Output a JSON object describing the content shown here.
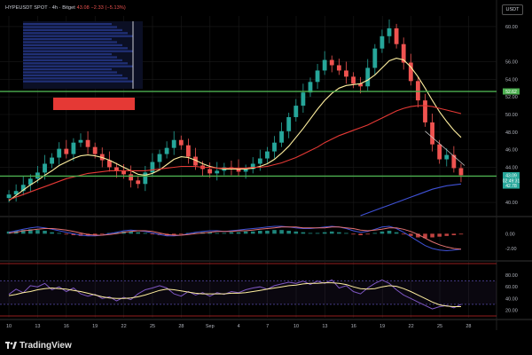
{
  "header": {
    "symbol": "HYPEUSDT SPOT · 4h · Bitget",
    "last": "43.08",
    "change": "−2.33 (−5.13%)"
  },
  "currency_label": "USDT",
  "branding": "TradingView",
  "colors": {
    "background": "#000000",
    "grid": "#1a1a1a",
    "up": "#26a69a",
    "down": "#ef5350",
    "ma_fast": "#ffef9f",
    "ma_mid": "#e53935",
    "ma_slow": "#3f51d6",
    "level": "#4caf50",
    "macd": "#3f51d6",
    "signal": "#e57373",
    "rsi": "#7e57c2",
    "rsi_ma": "#ffef9f"
  },
  "chart_data": [
    {
      "type": "line",
      "title": "",
      "ylabel": "",
      "xlabel": "",
      "x_tick_labels": [
        "10",
        "13",
        "16",
        "19",
        "22",
        "25",
        "28",
        "Sep",
        "4",
        "7",
        "10",
        "13",
        "16",
        "19",
        "22",
        "25",
        "28"
      ],
      "y_ticks": [
        "60.00",
        "56.00",
        "54.00",
        "52.00",
        "50.00",
        "48.00",
        "46.00",
        "44.00",
        "40.00"
      ],
      "ylim": [
        39.0,
        61.2
      ],
      "grid": true,
      "horizontal_levels": [
        {
          "value": 52.62,
          "label": "52.62"
        },
        {
          "value": 42.99,
          "label": "43.09"
        }
      ],
      "last_price_labels": [
        {
          "label": "43.09",
          "value": 43.09,
          "color": "#26a69a"
        },
        {
          "label": "02:49:31",
          "value": 42.5,
          "color": "#26a69a"
        },
        {
          "label": "42.78",
          "value": 41.92,
          "color": "#26a69a"
        }
      ],
      "series": [
        {
          "role": "close",
          "values": [
            40.9,
            41.3,
            42.0,
            42.7,
            43.4,
            44.4,
            45.1,
            46.1,
            45.5,
            46.8,
            47.1,
            46.3,
            45.5,
            44.8,
            44.0,
            43.6,
            43.2,
            42.5,
            42.1,
            43.4,
            44.6,
            45.5,
            46.2,
            47.1,
            46.5,
            45.2,
            44.2,
            43.8,
            43.3,
            43.6,
            44.0,
            43.9,
            43.5,
            43.8,
            44.4,
            45.0,
            45.8,
            46.8,
            48.1,
            49.7,
            51.0,
            52.5,
            53.7,
            55.0,
            56.2,
            55.6,
            55.0,
            54.3,
            53.5,
            53.2,
            55.3,
            57.5,
            58.9,
            59.8,
            58.0,
            55.9,
            53.8,
            51.6,
            49.1,
            46.6,
            44.9,
            45.4,
            43.9,
            43.1
          ]
        },
        {
          "role": "ma_fast",
          "values": [
            40.2,
            40.8,
            41.4,
            42.0,
            42.5,
            43.1,
            43.6,
            44.2,
            44.6,
            45.0,
            45.3,
            45.4,
            45.3,
            45.1,
            44.8,
            44.4,
            44.0,
            43.6,
            43.2,
            43.1,
            43.3,
            43.7,
            44.3,
            44.9,
            45.2,
            45.1,
            44.8,
            44.4,
            44.1,
            43.9,
            43.8,
            43.8,
            43.8,
            43.8,
            43.9,
            44.1,
            44.4,
            44.9,
            45.6,
            46.4,
            47.4,
            48.4,
            49.5,
            50.6,
            51.6,
            52.4,
            53.0,
            53.3,
            53.4,
            53.5,
            53.9,
            54.5,
            55.3,
            56.1,
            56.4,
            56.2,
            55.4,
            54.3,
            53.0,
            51.6,
            50.3,
            49.2,
            48.2,
            47.4
          ]
        },
        {
          "role": "ma_mid",
          "values": [
            40.3,
            40.6,
            40.9,
            41.2,
            41.5,
            41.8,
            42.1,
            42.4,
            42.7,
            42.9,
            43.1,
            43.3,
            43.4,
            43.5,
            43.6,
            43.6,
            43.6,
            43.6,
            43.6,
            43.6,
            43.7,
            43.8,
            43.9,
            44.0,
            44.1,
            44.1,
            44.1,
            44.0,
            44.0,
            43.9,
            43.9,
            43.9,
            43.9,
            43.9,
            44.0,
            44.0,
            44.1,
            44.3,
            44.5,
            44.8,
            45.1,
            45.5,
            45.9,
            46.3,
            46.8,
            47.2,
            47.6,
            47.9,
            48.2,
            48.5,
            48.8,
            49.2,
            49.6,
            50.0,
            50.4,
            50.7,
            50.9,
            51.0,
            51.0,
            50.9,
            50.7,
            50.5,
            50.3,
            50.1
          ]
        },
        {
          "role": "ma_slow",
          "start_index": 49,
          "values": [
            38.5,
            38.8,
            39.1,
            39.4,
            39.7,
            40.0,
            40.3,
            40.6,
            40.9,
            41.2,
            41.5,
            41.7,
            41.9,
            42.0,
            42.1
          ]
        }
      ]
    },
    {
      "type": "line",
      "title": "",
      "y_ticks": [
        "0.00",
        "-2.00"
      ],
      "ylim": [
        -3.2,
        1.6
      ],
      "series": [
        {
          "role": "macd_histogram",
          "values": [
            0.3,
            0.4,
            0.5,
            0.6,
            0.5,
            0.4,
            0.2,
            0.1,
            -0.1,
            -0.2,
            -0.3,
            -0.3,
            -0.2,
            -0.1,
            0.1,
            0.2,
            0.3,
            0.3,
            0.2,
            0.1,
            -0.1,
            -0.2,
            -0.3,
            -0.2,
            -0.1,
            0.1,
            0.1,
            0.2,
            0.2,
            0.1,
            0.1,
            0.2,
            0.2,
            0.3,
            0.3,
            0.4,
            0.4,
            0.5,
            0.5,
            0.4,
            0.3,
            0.2,
            0.1,
            0.1,
            0.2,
            0.3,
            0.2,
            0.1,
            -0.1,
            -0.2,
            -0.1,
            0.1,
            0.3,
            0.4,
            0.2,
            -0.1,
            -0.3,
            -0.5,
            -0.6,
            -0.5,
            -0.4,
            -0.3,
            -0.2,
            -0.1
          ]
        },
        {
          "role": "macd",
          "values": [
            0.2,
            0.4,
            0.6,
            0.8,
            0.9,
            0.8,
            0.6,
            0.4,
            0.2,
            0.0,
            -0.2,
            -0.3,
            -0.3,
            -0.2,
            0.0,
            0.2,
            0.4,
            0.5,
            0.4,
            0.3,
            0.1,
            -0.1,
            -0.3,
            -0.3,
            -0.2,
            0.0,
            0.2,
            0.3,
            0.4,
            0.4,
            0.3,
            0.4,
            0.5,
            0.6,
            0.7,
            0.8,
            0.9,
            1.0,
            1.0,
            0.9,
            0.8,
            0.7,
            0.7,
            0.8,
            0.9,
            1.0,
            0.9,
            0.7,
            0.4,
            0.2,
            0.3,
            0.6,
            0.9,
            1.0,
            0.7,
            0.2,
            -0.4,
            -1.0,
            -1.6,
            -2.0,
            -2.2,
            -2.3,
            -2.2,
            -2.1
          ]
        },
        {
          "role": "signal",
          "values": [
            0.1,
            0.2,
            0.4,
            0.5,
            0.6,
            0.7,
            0.7,
            0.6,
            0.5,
            0.3,
            0.1,
            -0.1,
            -0.2,
            -0.2,
            -0.1,
            0.0,
            0.2,
            0.3,
            0.4,
            0.4,
            0.3,
            0.1,
            -0.1,
            -0.2,
            -0.2,
            -0.1,
            0.0,
            0.1,
            0.2,
            0.3,
            0.3,
            0.3,
            0.4,
            0.4,
            0.5,
            0.6,
            0.7,
            0.8,
            0.9,
            0.9,
            0.9,
            0.8,
            0.8,
            0.8,
            0.8,
            0.9,
            0.9,
            0.8,
            0.7,
            0.5,
            0.4,
            0.5,
            0.6,
            0.8,
            0.8,
            0.6,
            0.3,
            -0.1,
            -0.6,
            -1.1,
            -1.5,
            -1.8,
            -2.0,
            -2.1
          ]
        }
      ]
    },
    {
      "type": "line",
      "title": "",
      "y_ticks": [
        "80.00",
        "60.00",
        "40.00",
        "20.00"
      ],
      "ylim": [
        10,
        100
      ],
      "bands": [
        30,
        70
      ],
      "series": [
        {
          "role": "rsi",
          "values": [
            47,
            56,
            50,
            62,
            60,
            66,
            55,
            60,
            52,
            58,
            48,
            44,
            47,
            40,
            43,
            36,
            42,
            38,
            48,
            55,
            58,
            62,
            58,
            48,
            44,
            52,
            46,
            50,
            44,
            50,
            47,
            52,
            50,
            55,
            58,
            60,
            56,
            62,
            65,
            68,
            66,
            70,
            64,
            70,
            66,
            72,
            58,
            62,
            52,
            48,
            58,
            66,
            72,
            66,
            55,
            46,
            40,
            34,
            28,
            22,
            26,
            28,
            24,
            30
          ]
        },
        {
          "role": "rsi_ma",
          "values": [
            45,
            47,
            50,
            52,
            55,
            57,
            58,
            57,
            56,
            54,
            52,
            49,
            46,
            43,
            41,
            40,
            40,
            41,
            43,
            46,
            50,
            54,
            56,
            55,
            53,
            51,
            49,
            48,
            48,
            48,
            48,
            49,
            49,
            50,
            52,
            54,
            56,
            58,
            60,
            62,
            63,
            65,
            66,
            66,
            67,
            67,
            66,
            64,
            60,
            57,
            56,
            57,
            60,
            62,
            61,
            57,
            52,
            46,
            40,
            34,
            29,
            27,
            26,
            26
          ]
        }
      ]
    }
  ],
  "inset": {
    "label": "order-book heatmap inset"
  }
}
